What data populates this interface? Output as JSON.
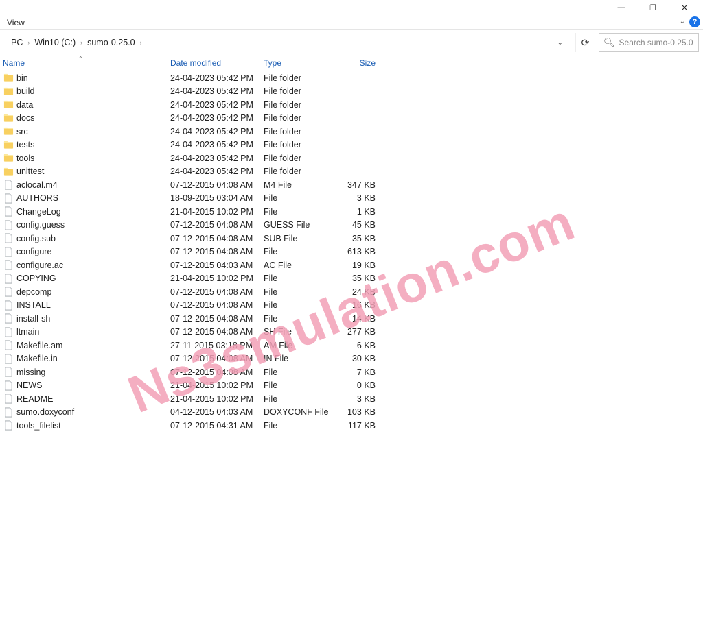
{
  "titlebar": {
    "minimize_glyph": "—",
    "maximize_glyph": "❐",
    "close_glyph": "✕"
  },
  "menubar": {
    "view_label": "View",
    "chevron_glyph": "⌄",
    "help_glyph": "?"
  },
  "breadcrumb": {
    "items": [
      "PC",
      "Win10 (C:)",
      "sumo-0.25.0"
    ],
    "sep_glyph": "›",
    "end_chevron": "⌄"
  },
  "refresh_glyph": "⟳",
  "search": {
    "placeholder": "Search sumo-0.25.0",
    "icon_glyph": "🔍︎"
  },
  "columns": {
    "name": "Name",
    "date": "Date modified",
    "type": "Type",
    "size": "Size",
    "sort_glyph": "⌃"
  },
  "rows": [
    {
      "kind": "folder",
      "name": "bin",
      "date": "24-04-2023 05:42 PM",
      "type": "File folder",
      "size": ""
    },
    {
      "kind": "folder",
      "name": "build",
      "date": "24-04-2023 05:42 PM",
      "type": "File folder",
      "size": ""
    },
    {
      "kind": "folder",
      "name": "data",
      "date": "24-04-2023 05:42 PM",
      "type": "File folder",
      "size": ""
    },
    {
      "kind": "folder",
      "name": "docs",
      "date": "24-04-2023 05:42 PM",
      "type": "File folder",
      "size": ""
    },
    {
      "kind": "folder",
      "name": "src",
      "date": "24-04-2023 05:42 PM",
      "type": "File folder",
      "size": ""
    },
    {
      "kind": "folder",
      "name": "tests",
      "date": "24-04-2023 05:42 PM",
      "type": "File folder",
      "size": ""
    },
    {
      "kind": "folder",
      "name": "tools",
      "date": "24-04-2023 05:42 PM",
      "type": "File folder",
      "size": ""
    },
    {
      "kind": "folder",
      "name": "unittest",
      "date": "24-04-2023 05:42 PM",
      "type": "File folder",
      "size": ""
    },
    {
      "kind": "file",
      "name": "aclocal.m4",
      "date": "07-12-2015 04:08 AM",
      "type": "M4 File",
      "size": "347 KB"
    },
    {
      "kind": "file",
      "name": "AUTHORS",
      "date": "18-09-2015 03:04 AM",
      "type": "File",
      "size": "3 KB"
    },
    {
      "kind": "file",
      "name": "ChangeLog",
      "date": "21-04-2015 10:02 PM",
      "type": "File",
      "size": "1 KB"
    },
    {
      "kind": "file",
      "name": "config.guess",
      "date": "07-12-2015 04:08 AM",
      "type": "GUESS File",
      "size": "45 KB"
    },
    {
      "kind": "file",
      "name": "config.sub",
      "date": "07-12-2015 04:08 AM",
      "type": "SUB File",
      "size": "35 KB"
    },
    {
      "kind": "file",
      "name": "configure",
      "date": "07-12-2015 04:08 AM",
      "type": "File",
      "size": "613 KB"
    },
    {
      "kind": "file",
      "name": "configure.ac",
      "date": "07-12-2015 04:03 AM",
      "type": "AC File",
      "size": "19 KB"
    },
    {
      "kind": "file",
      "name": "COPYING",
      "date": "21-04-2015 10:02 PM",
      "type": "File",
      "size": "35 KB"
    },
    {
      "kind": "file",
      "name": "depcomp",
      "date": "07-12-2015 04:08 AM",
      "type": "File",
      "size": "24 KB"
    },
    {
      "kind": "file",
      "name": "INSTALL",
      "date": "07-12-2015 04:08 AM",
      "type": "File",
      "size": "16 KB"
    },
    {
      "kind": "file",
      "name": "install-sh",
      "date": "07-12-2015 04:08 AM",
      "type": "File",
      "size": "14 KB"
    },
    {
      "kind": "file",
      "name": "ltmain",
      "date": "07-12-2015 04:08 AM",
      "type": "SH File",
      "size": "277 KB"
    },
    {
      "kind": "file",
      "name": "Makefile.am",
      "date": "27-11-2015 03:18 PM",
      "type": "AM File",
      "size": "6 KB"
    },
    {
      "kind": "file",
      "name": "Makefile.in",
      "date": "07-12-2015 04:08 AM",
      "type": "IN File",
      "size": "30 KB"
    },
    {
      "kind": "file",
      "name": "missing",
      "date": "07-12-2015 04:08 AM",
      "type": "File",
      "size": "7 KB"
    },
    {
      "kind": "file",
      "name": "NEWS",
      "date": "21-04-2015 10:02 PM",
      "type": "File",
      "size": "0 KB"
    },
    {
      "kind": "file",
      "name": "README",
      "date": "21-04-2015 10:02 PM",
      "type": "File",
      "size": "3 KB"
    },
    {
      "kind": "file",
      "name": "sumo.doxyconf",
      "date": "04-12-2015 04:03 AM",
      "type": "DOXYCONF File",
      "size": "103 KB"
    },
    {
      "kind": "file",
      "name": "tools_filelist",
      "date": "07-12-2015 04:31 AM",
      "type": "File",
      "size": "117 KB"
    }
  ],
  "watermark": "Ns3smulation.com"
}
